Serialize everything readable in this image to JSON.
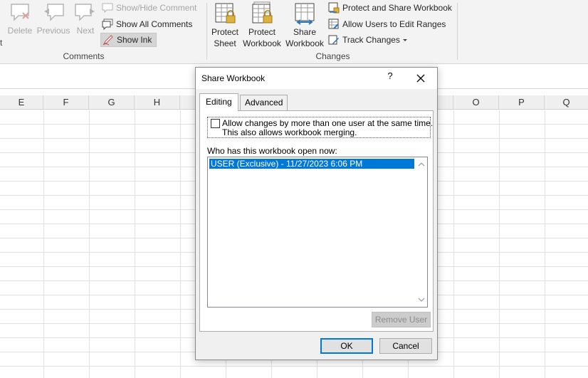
{
  "ribbon": {
    "comments_group": {
      "delete_label": "Delete",
      "previous_label": "Previous",
      "next_label": "Next",
      "show_hide_comment": "Show/Hide Comment",
      "show_all_comments": "Show All Comments",
      "show_ink": "Show Ink",
      "group_label": "Comments"
    },
    "changes_group": {
      "protect_sheet_line1": "Protect",
      "protect_sheet_line2": "Sheet",
      "protect_workbook_line1": "Protect",
      "protect_workbook_line2": "Workbook",
      "share_workbook_line1": "Share",
      "share_workbook_line2": "Workbook",
      "protect_and_share": "Protect and Share Workbook",
      "allow_users_edit_ranges": "Allow Users to Edit Ranges",
      "track_changes": "Track Changes",
      "group_label": "Changes"
    },
    "left_edge_fragment": "t"
  },
  "columns": [
    "E",
    "F",
    "G",
    "H",
    "O",
    "P",
    "Q"
  ],
  "dialog": {
    "title": "Share Workbook",
    "help": "?",
    "tabs": [
      {
        "label": "Editing",
        "active": true
      },
      {
        "label": "Advanced",
        "active": false
      }
    ],
    "allow_changes_line1": "Allow changes by more than one user at the same time.",
    "allow_changes_line2": "This also allows workbook merging.",
    "allow_changes_checked": false,
    "who_label": "Who has this workbook open now:",
    "users": [
      "USER (Exclusive) - 11/27/2023 6:06 PM"
    ],
    "remove_user_label": "Remove User",
    "ok_label": "OK",
    "cancel_label": "Cancel"
  },
  "colors": {
    "selection": "#0078d7",
    "ribbon_bg": "#f3f3f3",
    "dialog_bg": "#f0f0f0"
  }
}
